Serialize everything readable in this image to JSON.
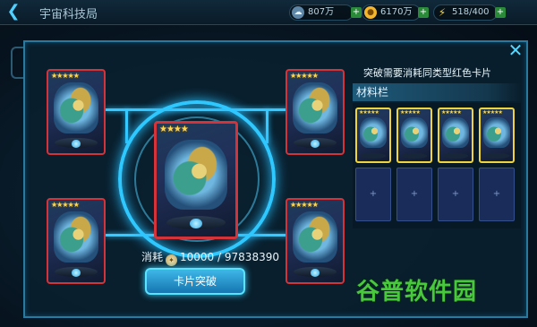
{
  "topbar": {
    "title": "宇宙科技局",
    "resources": [
      {
        "icon": "cloud-icon",
        "value": "807万",
        "color": "#a8c8e0"
      },
      {
        "icon": "coin-icon",
        "value": "6170万",
        "color": "#f3b62c"
      },
      {
        "icon": "lightning-icon",
        "value": "518/400",
        "color": "#f2d340"
      }
    ]
  },
  "panel": {
    "hint": "突破需要消耗同类型红色卡片",
    "materials_title": "材料栏",
    "cost_label": "消耗",
    "cost_value": "10000",
    "cost_separator": "/",
    "cost_owned": "97838390",
    "break_button": "卡片突破"
  },
  "cards": {
    "center_stars": "★★★★",
    "side_stars": "★★★★★",
    "material_stars": "★★★★★",
    "frame_color": "#d4333a",
    "material_frame_color": "#f0d43c"
  },
  "materials": {
    "filled": 4,
    "empty": 4,
    "empty_glyph": "+"
  },
  "watermark": "谷普软件园"
}
